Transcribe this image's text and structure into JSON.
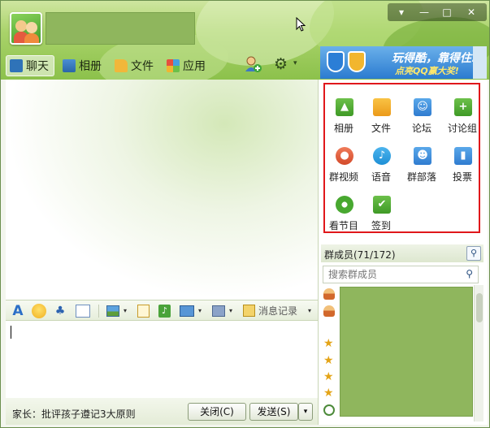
{
  "window": {
    "controls": {
      "menu": "▾",
      "minimize": "—",
      "maximize": "□",
      "close": "✕"
    }
  },
  "header": {
    "avatar_icon": "user-group-avatar",
    "tabs": [
      {
        "label": "聊天",
        "icon": "chat-icon",
        "active": true
      },
      {
        "label": "相册",
        "icon": "album-icon",
        "active": false
      },
      {
        "label": "文件",
        "icon": "folder-icon",
        "active": false
      },
      {
        "label": "应用",
        "icon": "apps-icon",
        "active": false
      }
    ],
    "tools": {
      "add_member_icon": "add-user-icon",
      "settings_icon": "gear-icon",
      "settings_caret": "▾"
    },
    "banner": {
      "line1": "玩得酷，靠得住!",
      "line2": "点亮QQ赢大奖!"
    }
  },
  "toolbar": {
    "font_glyph": "A",
    "history_label": "消息记录",
    "history_caret": "▾",
    "caret": "▾"
  },
  "bottom_bar": {
    "promo_text": "家长：批评孩子遵记3大原则",
    "close_button": "关闭(C)",
    "send_button": "发送(S)",
    "send_arrow": "▾"
  },
  "apps": [
    {
      "label": "相册",
      "color": "#5cb23a",
      "icon": "photo-icon",
      "glyph": "▲"
    },
    {
      "label": "文件",
      "color": "#f0ac2a",
      "icon": "folder-icon",
      "glyph": ""
    },
    {
      "label": "论坛",
      "color": "#3d8fdd",
      "icon": "forum-icon",
      "glyph": "☺"
    },
    {
      "label": "讨论组",
      "color": "#4aa52c",
      "icon": "discussion-icon",
      "glyph": "+"
    },
    {
      "label": "群视频",
      "color": "#e2623e",
      "icon": "video-icon",
      "glyph": "●"
    },
    {
      "label": "语音",
      "color": "#27a0e2",
      "icon": "voice-icon",
      "glyph": "♪"
    },
    {
      "label": "群部落",
      "color": "#3d8fdd",
      "icon": "tribe-icon",
      "glyph": "☻"
    },
    {
      "label": "投票",
      "color": "#3d8fdd",
      "icon": "vote-icon",
      "glyph": "▮"
    },
    {
      "label": "看节目",
      "color": "#48a830",
      "icon": "film-icon",
      "glyph": ""
    },
    {
      "label": "签到",
      "color": "#4aa52c",
      "icon": "checkin-icon",
      "glyph": "✔"
    }
  ],
  "members": {
    "title": "群成员(71/172)",
    "search_placeholder": "搜索群成员",
    "search_glyph": "⚲",
    "row_icons": [
      "person",
      "person",
      "star",
      "star",
      "star",
      "star",
      "bubble"
    ]
  }
}
